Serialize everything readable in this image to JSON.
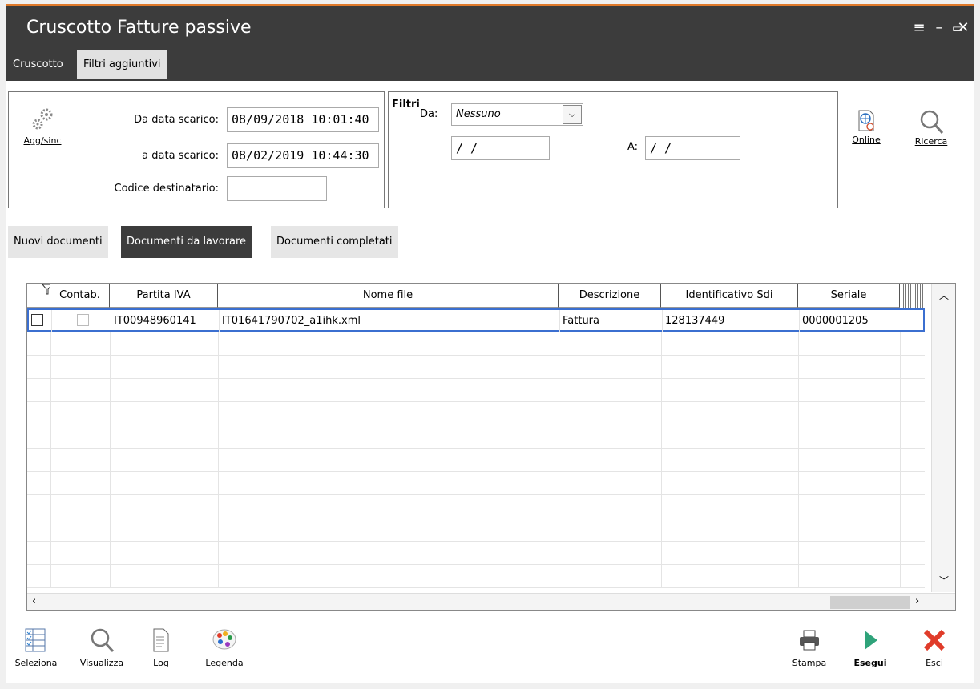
{
  "window": {
    "title": "Cruscotto Fatture passive",
    "controls": [
      "≡",
      "–",
      "▭",
      "✕"
    ]
  },
  "top_tabs": [
    {
      "label": "Cruscotto",
      "active": true
    },
    {
      "label": "Filtri aggiuntivi",
      "active": false
    }
  ],
  "header": {
    "agg_label": "Agg/sinc",
    "da_data_label": "Da data scarico:",
    "da_data_value": "08/09/2018 10:01:40",
    "a_data_label": "a data scarico:",
    "a_data_value": "08/02/2019 10:44:30",
    "codice_label": "Codice destinatario:",
    "codice_value": ""
  },
  "filtri": {
    "title": "Filtri",
    "da_label": "Da:",
    "da_selected": "Nessuno",
    "date_from": " /  /",
    "a_label": "A:",
    "date_to": " /  /"
  },
  "right_tools": {
    "online": "Online",
    "ricerca": "Ricerca"
  },
  "sub_tabs": [
    {
      "label": "Nuovi documenti",
      "active": false
    },
    {
      "label": "Documenti da lavorare",
      "active": true
    },
    {
      "label": "Documenti completati",
      "active": false
    }
  ],
  "grid": {
    "columns": [
      "",
      "Contab.",
      "Partita IVA",
      "Nome file",
      "Descrizione",
      "Identificativo Sdi",
      "Seriale"
    ],
    "rows": [
      {
        "partita_iva": "IT00948960141",
        "nome_file": "IT01641790702_a1ihk.xml",
        "descrizione": "Fattura",
        "identificativo": "128137449",
        "seriale": "0000001205"
      }
    ]
  },
  "bottom_tools": {
    "seleziona": "Seleziona",
    "visualizza": "Visualizza",
    "log": "Log",
    "legenda": "Legenda",
    "stampa": "Stampa",
    "esegui": "Esegui",
    "esci": "Esci"
  },
  "colors": {
    "titlebar": "#3c3c3c",
    "accent": "#e07a2a",
    "esegui": "#2fa37a",
    "esci": "#e03c2a",
    "selection_border": "#3b6fd0"
  }
}
